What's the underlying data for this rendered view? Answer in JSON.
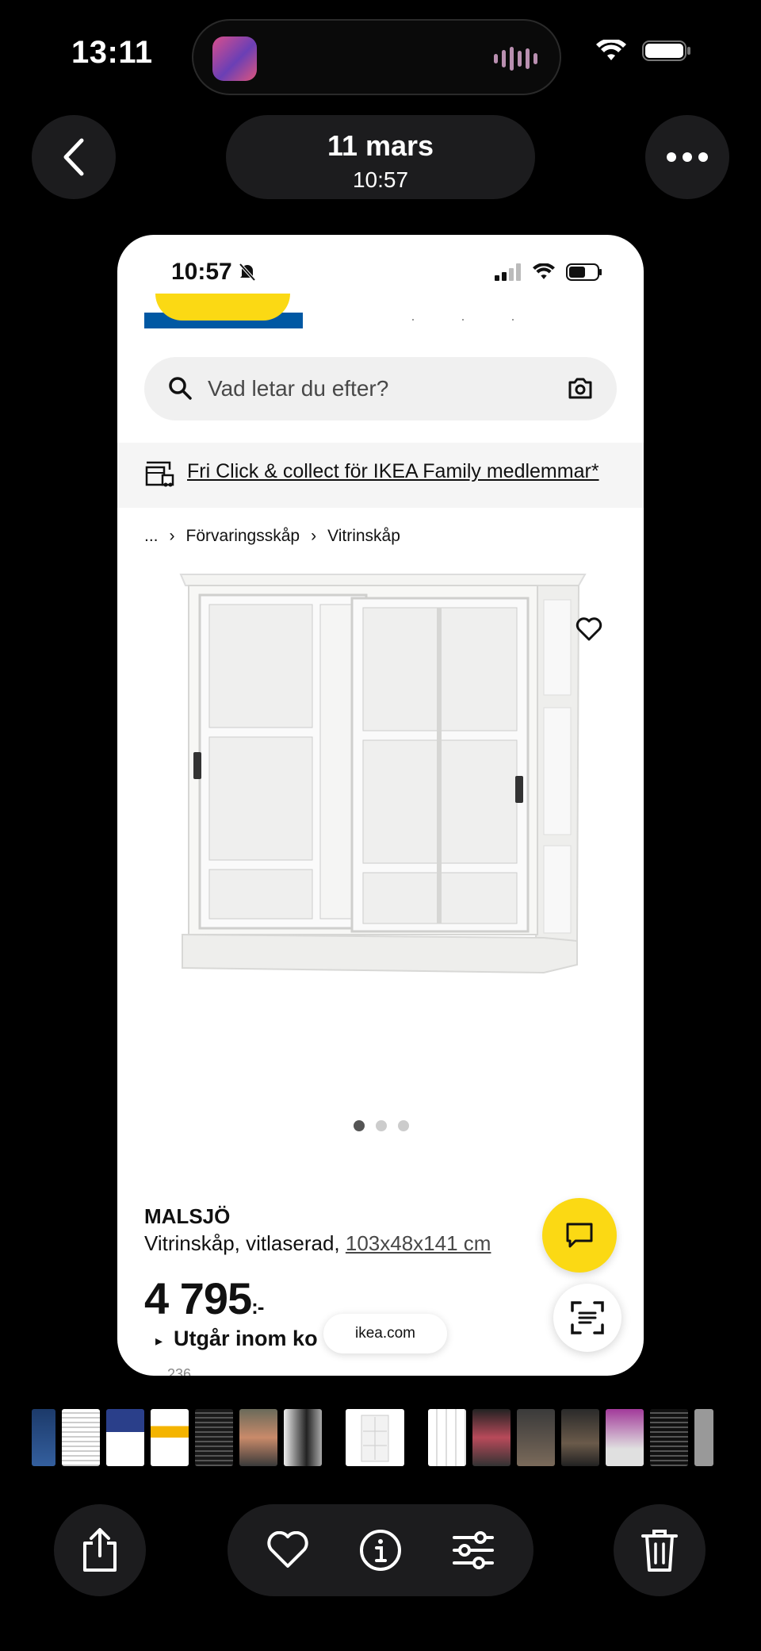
{
  "status_bar": {
    "time": "13:11"
  },
  "header": {
    "date": "11 mars",
    "time": "10:57"
  },
  "screenshot": {
    "status_time": "10:57",
    "search_placeholder": "Vad letar du efter?",
    "promo_text": "Fri Click & collect för IKEA Family medlemmar*",
    "breadcrumb": {
      "ellipsis": "...",
      "items": [
        "Förvaringsskåp",
        "Vitrinskåp"
      ]
    },
    "image_dots": {
      "total": 3,
      "active": 1
    },
    "product": {
      "name": "MALSJÖ",
      "description": "Vitrinskåp, vitlaserad,",
      "dimensions": "103x48x141 cm",
      "price": "4 795",
      "price_suffix": ":-",
      "availability": "Utgår inom ko",
      "cut_text": "… 236 … … …"
    },
    "url": "ikea.com"
  },
  "colors": {
    "ikea_blue": "#0058a3",
    "ikea_yellow": "#fbd914"
  },
  "icons": [
    "chevron-left-icon",
    "more-icon",
    "search-icon",
    "camera-icon",
    "store-icon",
    "heart-icon",
    "chat-icon",
    "scan-icon",
    "share-icon",
    "info-icon",
    "adjust-icon",
    "trash-icon"
  ]
}
